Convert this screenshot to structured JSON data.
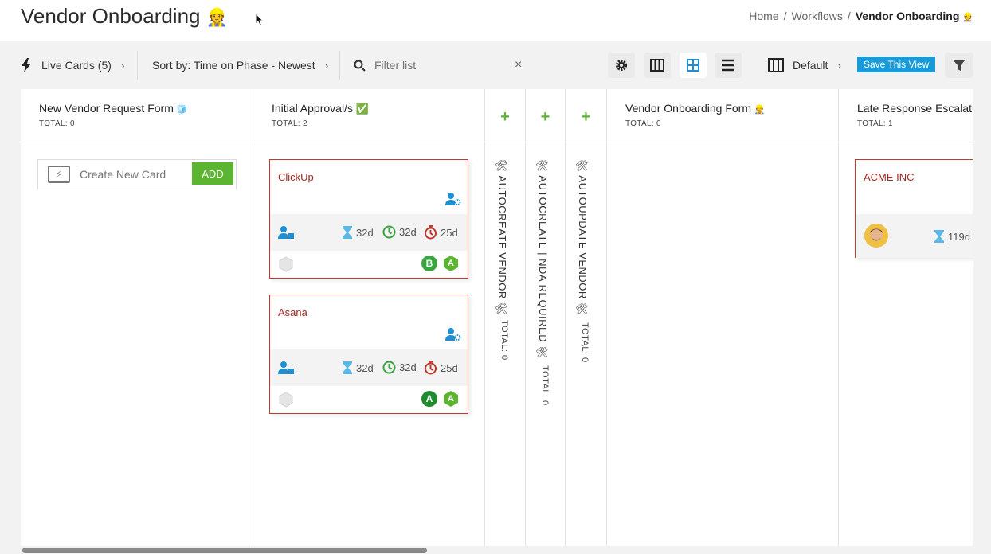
{
  "header": {
    "title": "Vendor Onboarding",
    "title_emoji": "👷",
    "breadcrumb": [
      "Home",
      "Workflows",
      "Vendor Onboarding"
    ],
    "breadcrumb_emoji": "👷"
  },
  "toolbar": {
    "live_cards": "Live Cards (5)",
    "sort_by": "Sort by: Time on Phase - Newest",
    "filter_placeholder": "Filter list",
    "view_name": "Default",
    "save_view": "Save This View"
  },
  "columns": [
    {
      "title": "New Vendor Request Form",
      "emoji": "🧊",
      "total": "TOTAL: 0",
      "new_card": {
        "label": "Create New Card",
        "add": "ADD"
      }
    },
    {
      "title": "Initial Approval/s",
      "emoji": "✅",
      "total": "TOTAL: 2"
    },
    {
      "title": "🛠 AUTOCREATE VENDOR 🛠",
      "total": "TOTAL: 0",
      "add": "+"
    },
    {
      "title": "🛠 AUTOCREATE | NDA REQUIRED 🛠",
      "total": "TOTAL: 0",
      "add": "+"
    },
    {
      "title": "🛠 AUTOUPDATE VENDOR 🛠",
      "total": "TOTAL: 0",
      "add": "+"
    },
    {
      "title": "Vendor Onboarding Form",
      "emoji": "👷",
      "total": "TOTAL: 0"
    },
    {
      "title": "Late Response Escalation",
      "total": "TOTAL: 1"
    }
  ],
  "cards": [
    {
      "name": "ClickUp",
      "due": "32d",
      "phase": "32d",
      "timer": "25d",
      "badges": [
        "B",
        "A"
      ]
    },
    {
      "name": "Asana",
      "due": "32d",
      "phase": "32d",
      "timer": "25d",
      "badges": [
        "A",
        "A"
      ]
    },
    {
      "name": "ACME INC",
      "due": "119d"
    }
  ],
  "colors": {
    "accent_green": "#5cb531",
    "card_border": "#c0392b",
    "save_blue": "#1a9ad6",
    "icon_blue": "#1f8fd1"
  }
}
